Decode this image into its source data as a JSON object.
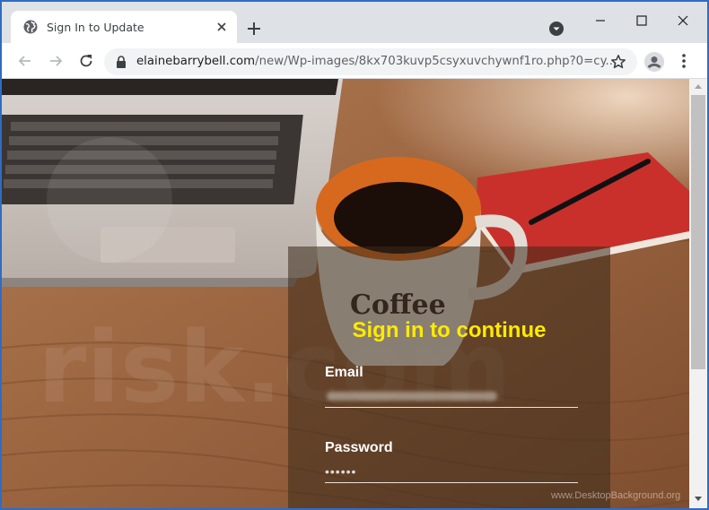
{
  "browser": {
    "tab": {
      "title": "Sign In to Update"
    },
    "address_bar": {
      "host": "elainebarrybell.com",
      "path": "/new/Wp-images/8kx703kuvp5csyxuvchywnf1ro.php?0=cy..."
    }
  },
  "page": {
    "form": {
      "title": "Sign in to continue",
      "email_label": "Email",
      "password_label": "Password",
      "password_value": "••••••"
    },
    "watermark": "www.DesktopBackground.org"
  },
  "colors": {
    "title_yellow": "#ffea00",
    "panel_bg": "#3a2a1a",
    "titlebar_bg": "#dee1e6"
  },
  "icons": [
    "globe-icon",
    "close-icon",
    "plus-icon",
    "profile-dropdown-icon",
    "minimize-icon",
    "maximize-icon",
    "window-close-icon",
    "back-arrow-icon",
    "forward-arrow-icon",
    "reload-icon",
    "lock-icon",
    "star-icon",
    "account-icon",
    "menu-dots-icon"
  ]
}
